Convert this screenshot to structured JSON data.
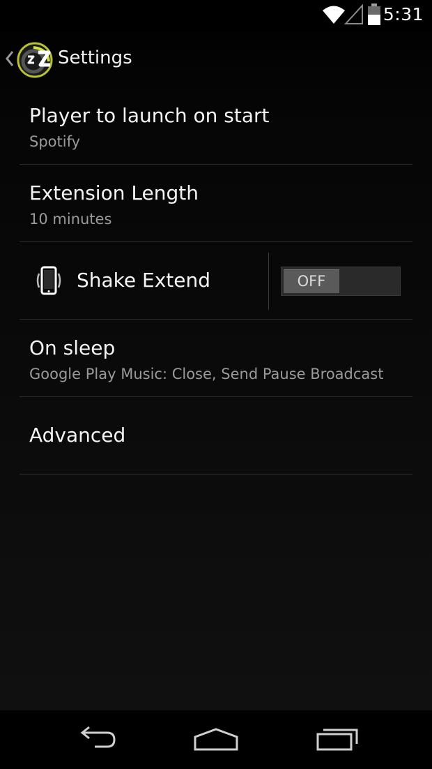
{
  "status_bar": {
    "time": "5:31",
    "icons": [
      "wifi-icon",
      "cell-signal-icon",
      "battery-icon"
    ]
  },
  "action_bar": {
    "title": "Settings",
    "icons": [
      "up-chevron-icon",
      "app-icon"
    ]
  },
  "settings": {
    "player_launch": {
      "title": "Player to launch on start",
      "summary": "Spotify"
    },
    "extension_length": {
      "title": "Extension Length",
      "summary": "10 minutes"
    },
    "shake_extend": {
      "title": "Shake Extend",
      "icon": "shake-phone-icon",
      "toggle_state": "OFF"
    },
    "on_sleep": {
      "title": "On sleep",
      "summary": "Google Play Music: Close, Send Pause Broadcast"
    },
    "advanced": {
      "title": "Advanced"
    }
  },
  "nav_bar": {
    "buttons": [
      "back-icon",
      "home-icon",
      "recents-icon"
    ]
  },
  "colors": {
    "background": "#000000",
    "primary_text": "#f4f4f4",
    "secondary_text": "#9a9a9a",
    "divider": "#2b2b2b",
    "toggle_track": "#2a2a2a",
    "toggle_thumb": "#5a5a5a",
    "app_icon_accent": "#c8d23a"
  }
}
